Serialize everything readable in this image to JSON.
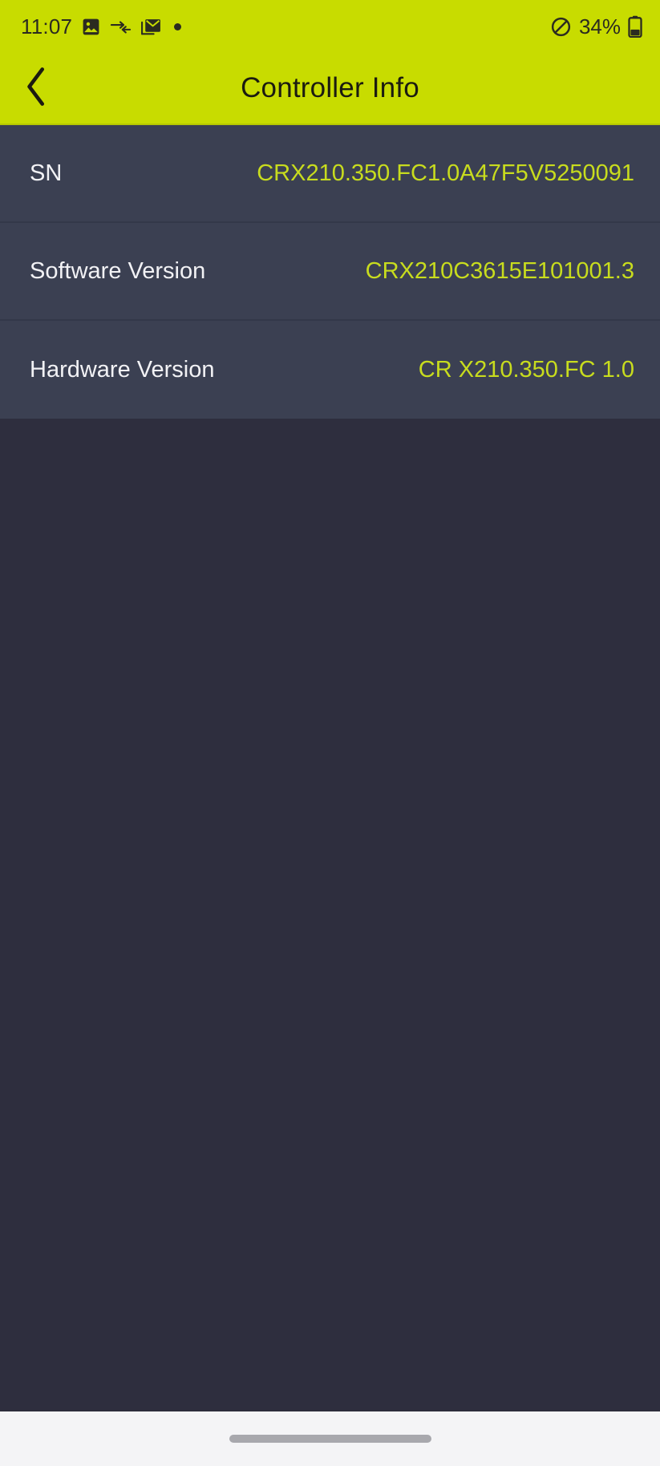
{
  "status_bar": {
    "time": "11:07",
    "battery_percent": "34%",
    "left_icons": [
      "photo-icon",
      "data-transfer-icon",
      "email-icon",
      "dot-icon"
    ],
    "right_icons": [
      "do-not-disturb-icon",
      "battery-icon"
    ]
  },
  "app_bar": {
    "title": "Controller Info",
    "back_icon": "chevron-left-icon",
    "background_color": "#c8dc00",
    "title_color": "#1b1b10"
  },
  "info_rows": [
    {
      "label": "SN",
      "value": "CRX210.350.FC1.0A47F5V5250091"
    },
    {
      "label": "Software Version",
      "value": "CRX210C3615E101001.3"
    },
    {
      "label": "Hardware Version",
      "value": "CR X210.350.FC 1.0"
    }
  ],
  "theme": {
    "accent": "#c8dc00",
    "value_text": "#c8dc1e",
    "row_background": "#3b4052",
    "page_background": "#2e2e3e",
    "label_text": "#f2f2f5"
  },
  "nav_bar": {
    "handle": "gesture-pill"
  }
}
